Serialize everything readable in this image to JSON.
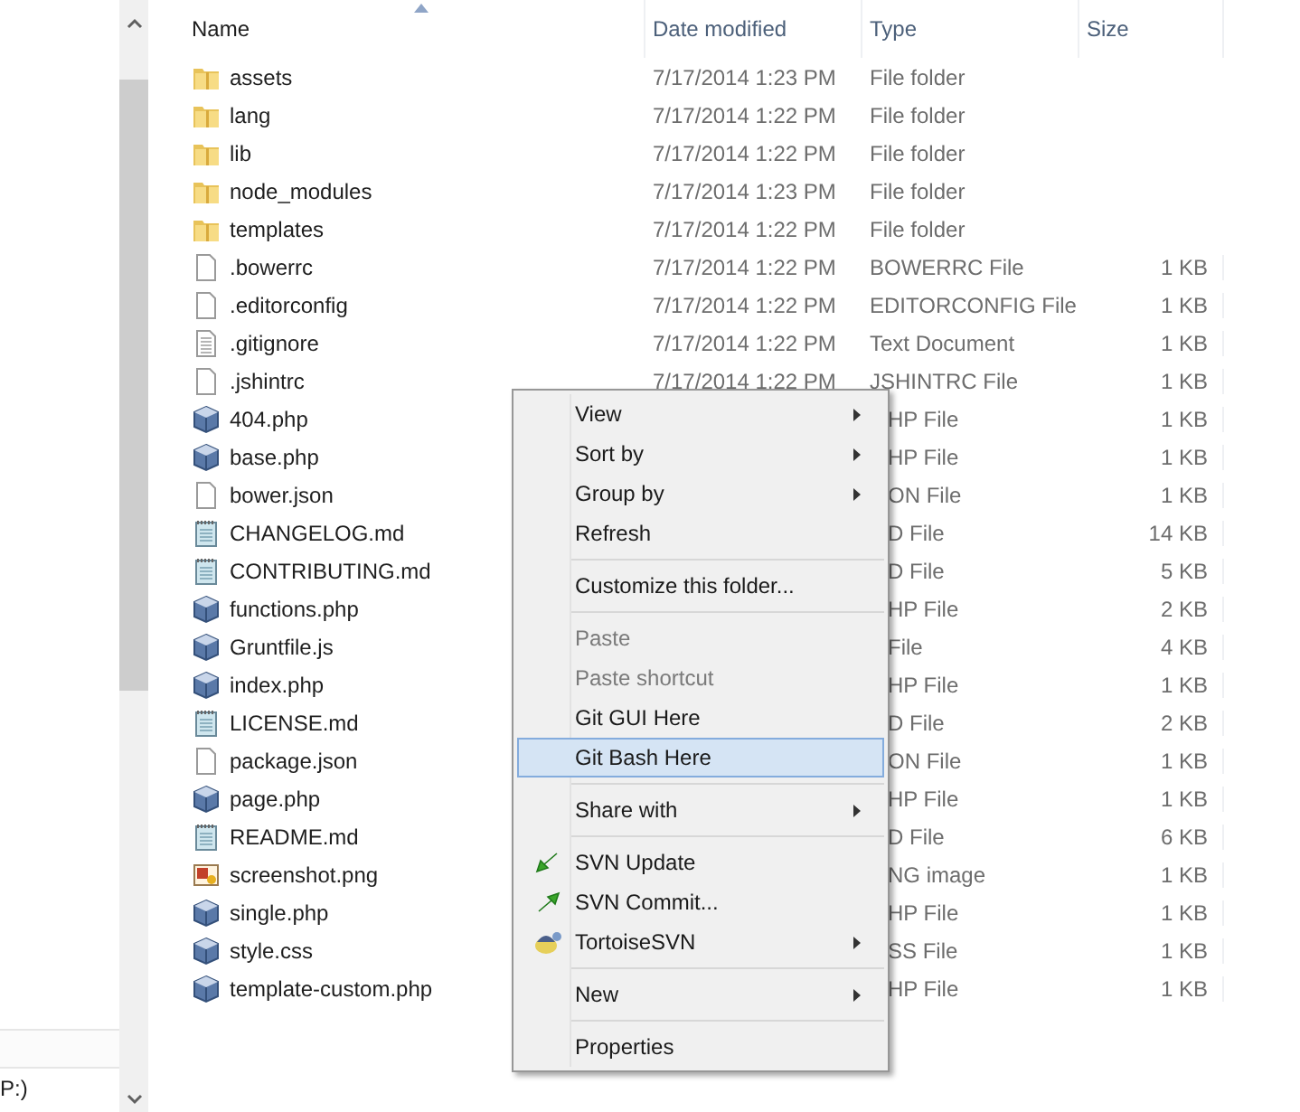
{
  "nav_pane": {
    "drive_label": "P:)"
  },
  "columns": [
    {
      "label": "Name",
      "sorted": true
    },
    {
      "label": "Date modified",
      "sorted": false
    },
    {
      "label": "Type",
      "sorted": false
    },
    {
      "label": "Size",
      "sorted": false
    }
  ],
  "files": [
    {
      "kind": "folder",
      "name": "assets",
      "date": "7/17/2014 1:23 PM",
      "type": "File folder"
    },
    {
      "kind": "folder",
      "name": "lang",
      "date": "7/17/2014 1:22 PM",
      "type": "File folder"
    },
    {
      "kind": "folder",
      "name": "lib",
      "date": "7/17/2014 1:22 PM",
      "type": "File folder"
    },
    {
      "kind": "folder",
      "name": "node_modules",
      "date": "7/17/2014 1:23 PM",
      "type": "File folder"
    },
    {
      "kind": "folder",
      "name": "templates",
      "date": "7/17/2014 1:22 PM",
      "type": "File folder"
    },
    {
      "kind": "file",
      "name": ".bowerrc",
      "date": "7/17/2014 1:22 PM",
      "type": "BOWERRC File",
      "size": "1 KB"
    },
    {
      "kind": "file",
      "name": ".editorconfig",
      "date": "7/17/2014 1:22 PM",
      "type": "EDITORCONFIG File",
      "size": "1 KB"
    },
    {
      "kind": "text",
      "name": ".gitignore",
      "date": "7/17/2014 1:22 PM",
      "type": "Text Document",
      "size": "1 KB"
    },
    {
      "kind": "file",
      "name": ".jshintrc",
      "date": "7/17/2014 1:22 PM",
      "type": "JSHINTRC File",
      "size": "1 KB"
    },
    {
      "kind": "script",
      "name": "404.php",
      "type": "HP File",
      "size": "1 KB"
    },
    {
      "kind": "script",
      "name": "base.php",
      "type": "HP File",
      "size": "1 KB"
    },
    {
      "kind": "file",
      "name": "bower.json",
      "type": "ON File",
      "size": "1 KB"
    },
    {
      "kind": "notes",
      "name": "CHANGELOG.md",
      "type": "D File",
      "size": "14 KB"
    },
    {
      "kind": "notes",
      "name": "CONTRIBUTING.md",
      "type": "D File",
      "size": "5 KB"
    },
    {
      "kind": "script",
      "name": "functions.php",
      "type": "HP File",
      "size": "2 KB"
    },
    {
      "kind": "script",
      "name": "Gruntfile.js",
      "type": "File",
      "size": "4 KB"
    },
    {
      "kind": "script",
      "name": "index.php",
      "type": "HP File",
      "size": "1 KB"
    },
    {
      "kind": "notes",
      "name": "LICENSE.md",
      "type": "D File",
      "size": "2 KB"
    },
    {
      "kind": "file",
      "name": "package.json",
      "type": "ON File",
      "size": "1 KB"
    },
    {
      "kind": "script",
      "name": "page.php",
      "type": "HP File",
      "size": "1 KB"
    },
    {
      "kind": "notes",
      "name": "README.md",
      "type": "D File",
      "size": "6 KB"
    },
    {
      "kind": "image",
      "name": "screenshot.png",
      "type": "NG image",
      "size": "1 KB"
    },
    {
      "kind": "script",
      "name": "single.php",
      "type": "HP File",
      "size": "1 KB"
    },
    {
      "kind": "script",
      "name": "style.css",
      "type": "SS File",
      "size": "1 KB"
    },
    {
      "kind": "script",
      "name": "template-custom.php",
      "type": "HP File",
      "size": "1 KB"
    }
  ],
  "context_menu": [
    {
      "kind": "item",
      "label": "View",
      "submenu": true,
      "disabled": false,
      "selected": false
    },
    {
      "kind": "item",
      "label": "Sort by",
      "submenu": true,
      "disabled": false,
      "selected": false
    },
    {
      "kind": "item",
      "label": "Group by",
      "submenu": true,
      "disabled": false,
      "selected": false
    },
    {
      "kind": "item",
      "label": "Refresh",
      "submenu": false,
      "disabled": false,
      "selected": false
    },
    {
      "kind": "separator"
    },
    {
      "kind": "item",
      "label": "Customize this folder...",
      "submenu": false,
      "disabled": false,
      "selected": false
    },
    {
      "kind": "separator"
    },
    {
      "kind": "item",
      "label": "Paste",
      "submenu": false,
      "disabled": true,
      "selected": false
    },
    {
      "kind": "item",
      "label": "Paste shortcut",
      "submenu": false,
      "disabled": true,
      "selected": false
    },
    {
      "kind": "item",
      "label": "Git GUI Here",
      "submenu": false,
      "disabled": false,
      "selected": false
    },
    {
      "kind": "item",
      "label": "Git Bash Here",
      "submenu": false,
      "disabled": false,
      "selected": true
    },
    {
      "kind": "separator"
    },
    {
      "kind": "item",
      "label": "Share with",
      "submenu": true,
      "disabled": false,
      "selected": false
    },
    {
      "kind": "separator"
    },
    {
      "kind": "icon_item",
      "label": "SVN Update",
      "submenu": false,
      "disabled": false,
      "selected": false
    },
    {
      "kind": "icon_item",
      "label": "SVN Commit...",
      "submenu": false,
      "disabled": false,
      "selected": false
    },
    {
      "kind": "icon_item",
      "label": "TortoiseSVN",
      "submenu": true,
      "disabled": false,
      "selected": false
    },
    {
      "kind": "separator"
    },
    {
      "kind": "item",
      "label": "New",
      "submenu": true,
      "disabled": false,
      "selected": false
    },
    {
      "kind": "separator"
    },
    {
      "kind": "item",
      "label": "Properties",
      "submenu": false,
      "disabled": false,
      "selected": false
    }
  ]
}
